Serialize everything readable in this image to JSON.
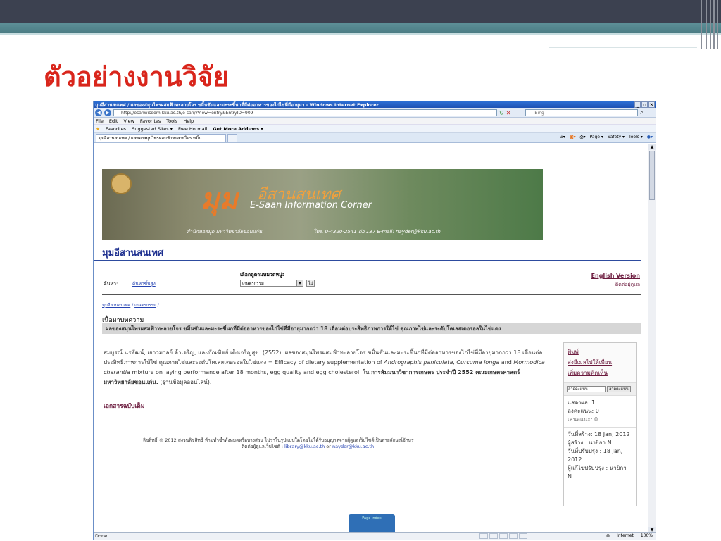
{
  "slide": {
    "title": "ตัวอย่างงานวิจัย"
  },
  "browser": {
    "window_title": "มุมอีสานสนเทศ / ผลของสมุนไพรผสมฟ้าทะลายโจร ขมิ้นชันและมะระขี้นกที่มีต่ออาหารของไก่ไข่ที่มีอายุมา - Windows Internet Explorer",
    "url": "http://esanwisdom.kku.ac.th/e-san/?View=entry&EntryID=909",
    "search_placeholder": "Bing",
    "menu": [
      "File",
      "Edit",
      "View",
      "Favorites",
      "Tools",
      "Help"
    ],
    "favorites_label": "Favorites",
    "fav_items": [
      "Suggested Sites ▾",
      "Free Hotmail",
      "Get More Add-ons ▾"
    ],
    "tab_label": "มุมอีสานสนเทศ / ผลของสมุนไพรผสมฟ้าทะลายโจร ขมิ้น...",
    "cmd_items": [
      "Page ▾",
      "Safety ▾",
      "Tools ▾"
    ],
    "status_left": "Done",
    "zone": "Internet",
    "zoom": "100%"
  },
  "banner": {
    "big_text": "มุม",
    "sub_text": "อีสานสนเทศ",
    "eng_text": "E-Saan Information Corner",
    "bottom_text": "สำนักหอสมุด มหาวิทยาลัยขอนแก่น",
    "tel_text": "โทร. 0-4320-2541 ต่อ 137  E-mail: nayder@kku.ac.th"
  },
  "site": {
    "name": "มุมอีสานสนเทศ",
    "search_label": "ค้นหา:",
    "advanced_search": "ค้นหาขั้นสูง",
    "category_label": "เลือกดูตามหมวดหมู่:",
    "category_value": "เกษตรกรรม",
    "go_label": "ไป",
    "english_version": "English Version",
    "contact_admin": "ติดต่อผู้ดูแล",
    "breadcrumb_home": "มุมอีสานสนเทศ",
    "breadcrumb_cat": "เกษตรกรรม",
    "section_heading": "เนื้อหาบทความ",
    "article_title": "ผลของสมุนไพรผสมฟ้าทะลายโจร ขมิ้นชันและมะระขี้นกที่มีต่ออาหารของไก่ไข่ที่มีอายุมากกว่า 18 เดือนต่อประสิทธิภาพการให้ไข่ คุณภาพไข่และระดับโคเลสเตอรอลในไข่แดง",
    "citation_1": "สมบูรณ์ นรพัฒน์, เยาวมาลย์ ค้าเจริญ, และบัณฑิตย์ เต็งเจริญสุข.  (2552).   ผลของสมุนไพรผสมฟ้าทะลายโจร ขมิ้นชันและมะระขี้นกที่มีต่ออาหารของไก่ไข่ที่มีอายุมากกว่า 18 เดือนต่อประสิทธิภาพการให้ไข่ คุณภาพไข่และระดับโคเลสเตอรอลในไข่แดง = Efficacy of dietary supplementation of ",
    "citation_i1": "Andrographis paniculata, Curcuma longa",
    "citation_2": " and ",
    "citation_i2": "Mormodica charantia",
    "citation_3": " mixture on laying performance after 18 months, egg quality and egg cholesterol.  ใน ",
    "citation_b": "การสัมมนาวิชาการเกษตร ประจำปี 2552 คณะเกษตรศาสตร์ มหาวิทยาลัยขอนแก่น.",
    "citation_4": "  (ฐานข้อมูลออนไลน์).",
    "original_doc": "เอกสารฉบับเต็ม",
    "copyright_1": "ลิขสิทธิ์ © 2012 สงวนลิขสิทธิ์ ห้ามทำซ้ำทั้งหมดหรือบางส่วน ไม่ว่าในรูปแบบใดโดยไม่ได้รับอนุญาตจากผู้ดูแลเว็บไซต์เป็นลายลักษณ์อักษร",
    "copyright_2": "ติดต่อผู้ดูแลเว็บไซต์ : ",
    "email_1": "library@kku.ac.th",
    "or_text": " or ",
    "email_2": "nayder@kku.ac.th"
  },
  "sidebar": {
    "print": "พิมพ์",
    "email_friend": "ส่งอีเมลไปให้เพื่อน",
    "add_comment": "เพิ่มความคิดเห็น",
    "rate_select": "ลาดคะแนน",
    "rate_button": "ลาดคะแนน",
    "views": "แสดงผล: 1",
    "votes": "ลงคะแนน: 0",
    "score": "เสนอแนะ: 0",
    "created": "วันที่สร้าง: 18 Jan, 2012",
    "creator": "ผู้สร้าง : นายิกา N.",
    "updated": "วันที่ปรับปรุง : 18 Jan, 2012",
    "editor": "ผู้แก้ไขปรับปรุง : นายิกา N."
  },
  "page_index_label": "Page Index"
}
